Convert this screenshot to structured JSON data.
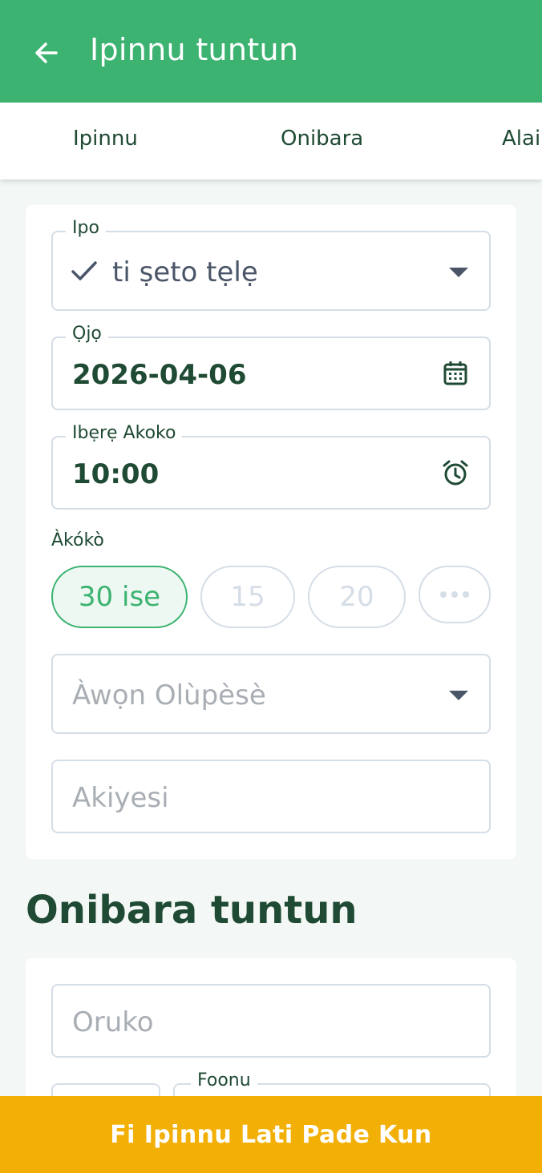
{
  "appbar": {
    "title": "Ipinnu tuntun",
    "back_icon": "arrow-left-icon"
  },
  "tabs": [
    {
      "label": "Ipinnu"
    },
    {
      "label": "Onibara"
    },
    {
      "label": "Alai"
    }
  ],
  "form": {
    "status": {
      "label": "Ipo",
      "value": "ti ṣeto tẹlẹ",
      "check_icon": "check-icon",
      "dropdown_icon": "chevron-down-icon"
    },
    "date": {
      "label": "Ọjọ",
      "value": "2026-04-06",
      "icon": "calendar-icon"
    },
    "start_time": {
      "label": "Ibẹrẹ Akoko",
      "value": "10:00",
      "icon": "alarm-clock-icon"
    },
    "duration": {
      "label": "Àkókò",
      "options": [
        "30 ise",
        "15",
        "20"
      ],
      "selected": "30 ise",
      "more_icon": "more-horizontal-icon"
    },
    "staff": {
      "placeholder": "Àwọn Olùpèsè",
      "dropdown_icon": "chevron-down-icon"
    },
    "notes": {
      "placeholder": "Akiyesi"
    }
  },
  "customer_section": {
    "title": "Onibara tuntun",
    "name": {
      "placeholder": "Oruko"
    },
    "phone": {
      "label": "Foonu"
    }
  },
  "footer": {
    "button_label": "Fi Ipinnu Lati Pade Kun"
  },
  "colors": {
    "primary": "#3CB371",
    "accent": "#F2B007",
    "text": "#1F4A33",
    "border": "#D5DDE6"
  }
}
